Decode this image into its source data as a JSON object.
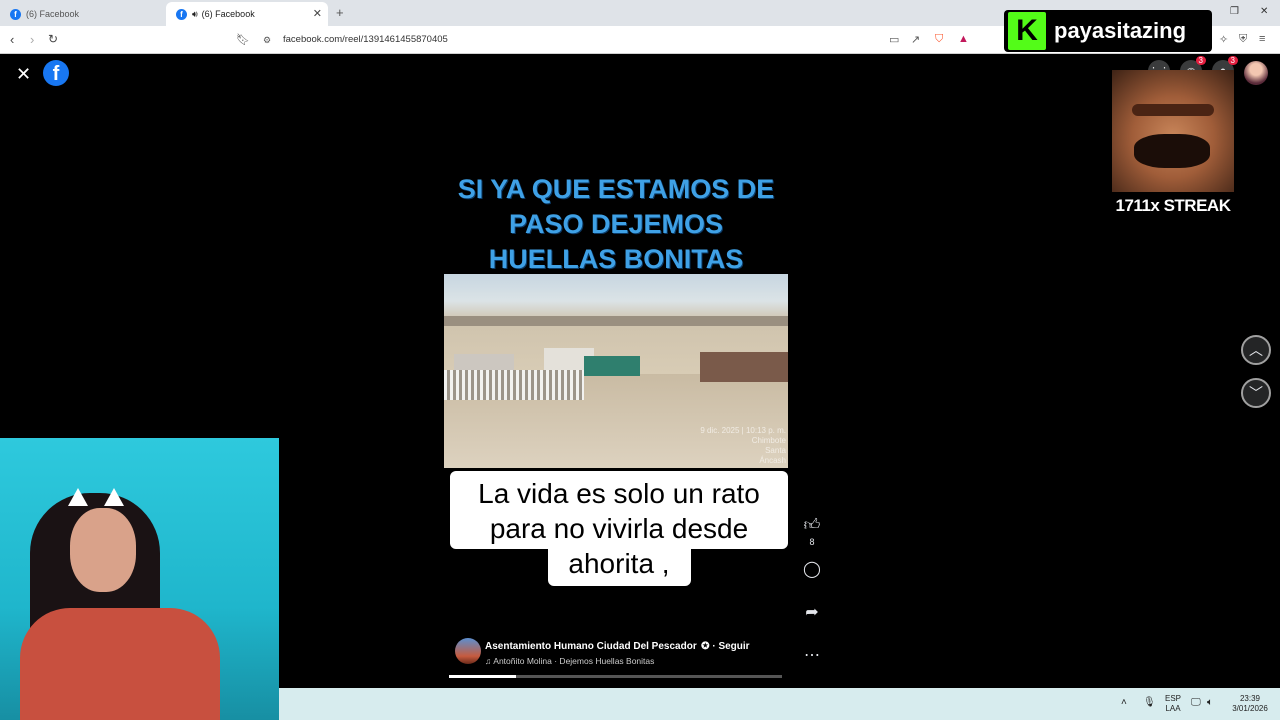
{
  "browser": {
    "tabs": [
      {
        "title": "(6) Facebook"
      },
      {
        "title": "(6) Facebook"
      }
    ],
    "url": "facebook.com/reel/1391461455870405"
  },
  "stream_overlay": {
    "kick_letter": "K",
    "channel_name": "payasitazing",
    "streak_text": "1711x STREAK"
  },
  "facebook": {
    "logo_letter": "f",
    "notification_badges": [
      "3",
      "3"
    ]
  },
  "reel": {
    "top_caption": "SI YA QUE ESTAMOS DE PASO DEJEMOS HUELLAS BONITAS",
    "video_stamp": [
      "9 dic. 2025 | 10:13 p. m.",
      "Chimbote",
      "Santa",
      "Áncash"
    ],
    "overlay_caption": "La vida es solo un rato para no vivirla desde ahorita ,",
    "like_count": "8",
    "author": "Asentamiento Humano Ciudad Del Pescador",
    "follow_label": "Seguir",
    "song": "Antoñito Molina · Dejemos Huellas Bonitas",
    "progress": 0.2
  },
  "taskbar": {
    "lang_line1": "ESP",
    "lang_line2": "LAA",
    "time": "23:39",
    "date": "3/01/2026"
  }
}
